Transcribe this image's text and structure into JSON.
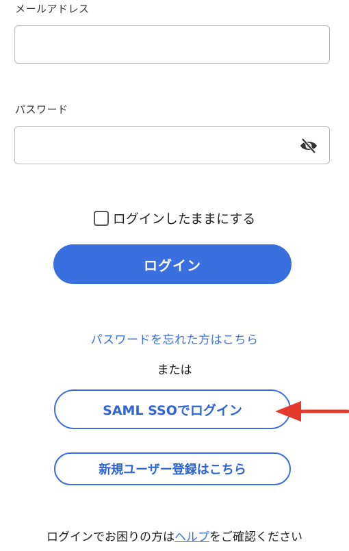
{
  "form": {
    "email": {
      "label": "メールアドレス",
      "value": "",
      "placeholder": ""
    },
    "password": {
      "label": "パスワード",
      "value": "",
      "placeholder": "",
      "visibility_icon": "eye-slash-icon"
    },
    "remember_label": "ログインしたままにする",
    "remember_checked": false,
    "login_label": "ログイン"
  },
  "links": {
    "forgot_password": "パスワードを忘れた方はこちら",
    "or_text": "または",
    "saml_label": "SAML SSOでログイン",
    "register_label": "新規ユーザー登録はこちら"
  },
  "help": {
    "prefix": "ログインでお困りの方は",
    "link": "ヘルプ",
    "suffix": "をご確認ください"
  },
  "annotation": {
    "arrow_color": "#e53a2b",
    "icon": "arrow-left-icon"
  },
  "colors": {
    "primary": "#3a6fe0",
    "link": "#3b73e3"
  }
}
